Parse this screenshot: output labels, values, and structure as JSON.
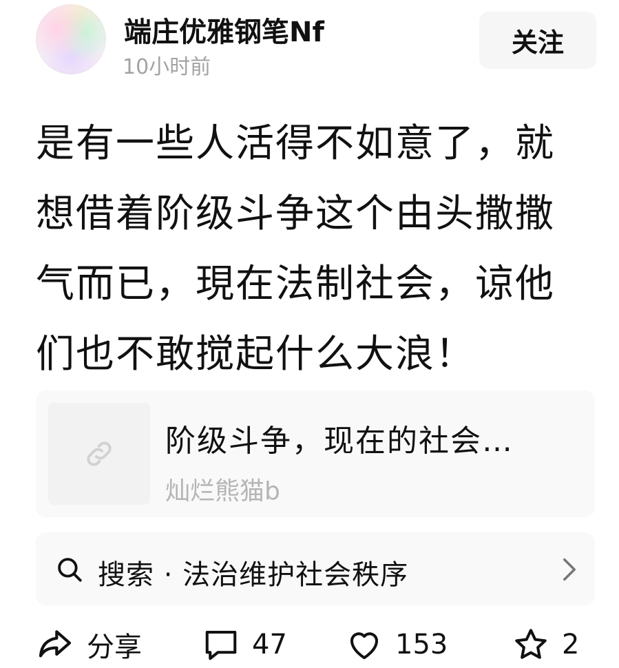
{
  "author": {
    "name": "端庄优雅钢笔Nf",
    "time": "10小时前",
    "avatar_icon": "avatar-image"
  },
  "follow": {
    "label": "关注"
  },
  "post": {
    "text": "是有一些人活得不如意了，就想借着阶级斗争这个由头撒撒气而已，現在法制社会，谅他们也不敢搅起什么大浪！"
  },
  "link_card": {
    "title": "阶级斗争，现在的社会…",
    "author": "灿烂熊猫b",
    "icon": "link-icon"
  },
  "search": {
    "prefix": "搜索",
    "separator": "·",
    "query": "法治维护社会秩序",
    "label": "搜索 · 法治维护社会秩序",
    "icon": "search-icon",
    "chevron": "chevron-right-icon"
  },
  "actions": {
    "share": {
      "label": "分享",
      "icon": "share-icon"
    },
    "comment": {
      "count": "47",
      "icon": "comment-icon"
    },
    "like": {
      "count": "153",
      "icon": "heart-icon"
    },
    "favorite": {
      "count": "2",
      "icon": "star-icon"
    }
  },
  "colors": {
    "text": "#111111",
    "muted": "#a3a3a3",
    "card_bg": "#f9f9fa",
    "button_bg": "#f6f6f6"
  }
}
